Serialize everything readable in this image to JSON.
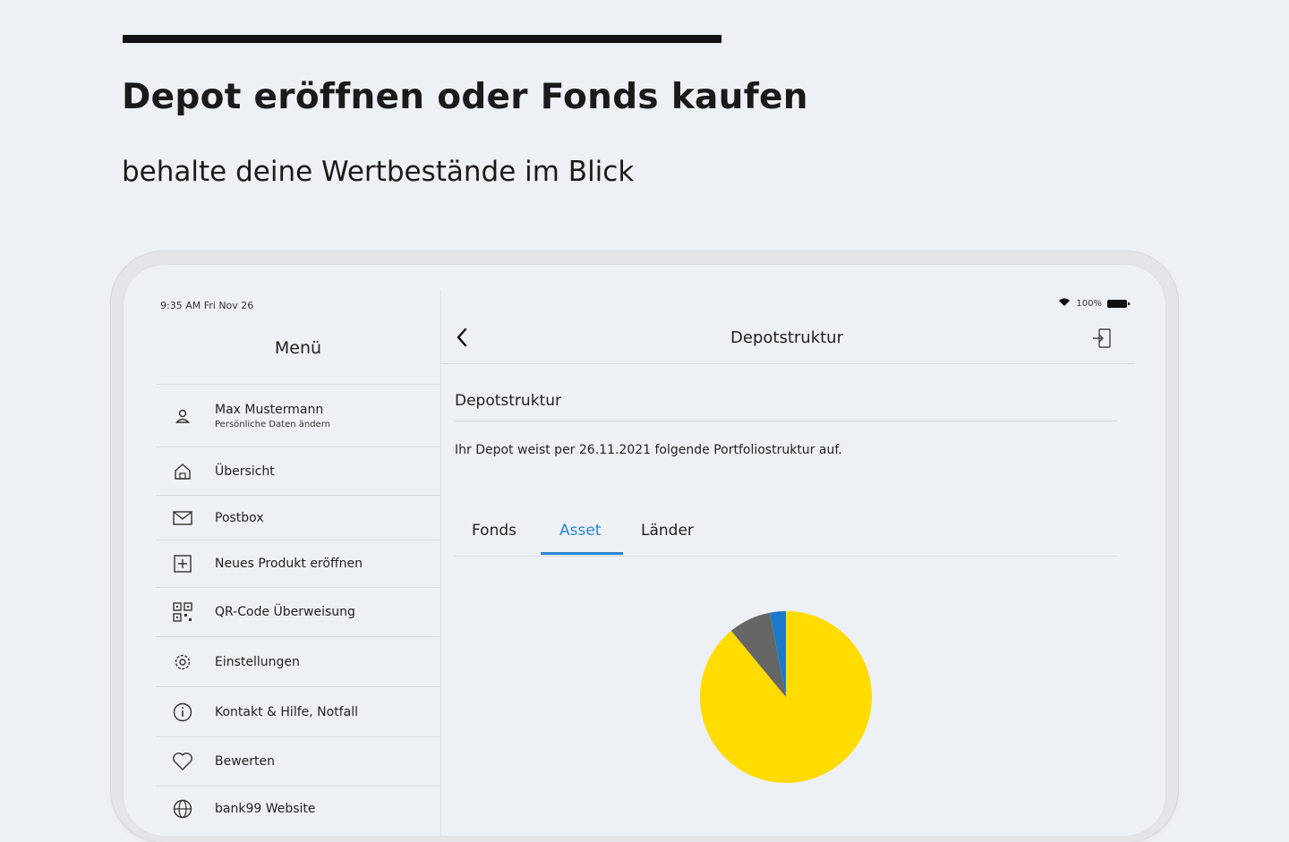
{
  "promo": {
    "headline": "Depot eröffnen oder Fonds kaufen",
    "subline": "behalte deine Wertbestände im Blick"
  },
  "status_bar": {
    "time": "9:35 AM   Fri Nov 26",
    "battery": "100%"
  },
  "sidebar": {
    "title": "Menü",
    "user": {
      "name": "Max Mustermann",
      "subtitle": "Persönliche Daten ändern",
      "icon": "person-icon"
    },
    "items": [
      {
        "label": "Übersicht",
        "icon": "home-icon"
      },
      {
        "label": "Postbox",
        "icon": "mail-icon"
      },
      {
        "label": "Neues Produkt eröffnen",
        "icon": "plus-box-icon"
      },
      {
        "label": "QR-Code Überweisung",
        "icon": "qr-code-icon"
      },
      {
        "label": "Einstellungen",
        "icon": "gear-icon"
      },
      {
        "label": "Kontakt & Hilfe, Notfall",
        "icon": "info-icon"
      },
      {
        "label": "Bewerten",
        "icon": "heart-icon"
      },
      {
        "label": "bank99 Website",
        "icon": "globe-icon"
      }
    ]
  },
  "main": {
    "nav_title": "Depotstruktur",
    "section_title": "Depotstruktur",
    "description": "Ihr Depot weist per 26.11.2021 folgende Portfoliostruktur auf.",
    "tabs": [
      {
        "label": "Fonds",
        "active": false
      },
      {
        "label": "Asset",
        "active": true
      },
      {
        "label": "Länder",
        "active": false
      }
    ]
  },
  "colors": {
    "accent": "#2b87d3",
    "pie_yellow": "#ffdb00",
    "pie_gray": "#666666",
    "pie_blue": "#1b7ac9"
  },
  "chart_data": {
    "type": "pie",
    "values": [
      89,
      8,
      3
    ],
    "colors": [
      "#ffdb00",
      "#666666",
      "#1b7ac9"
    ]
  }
}
